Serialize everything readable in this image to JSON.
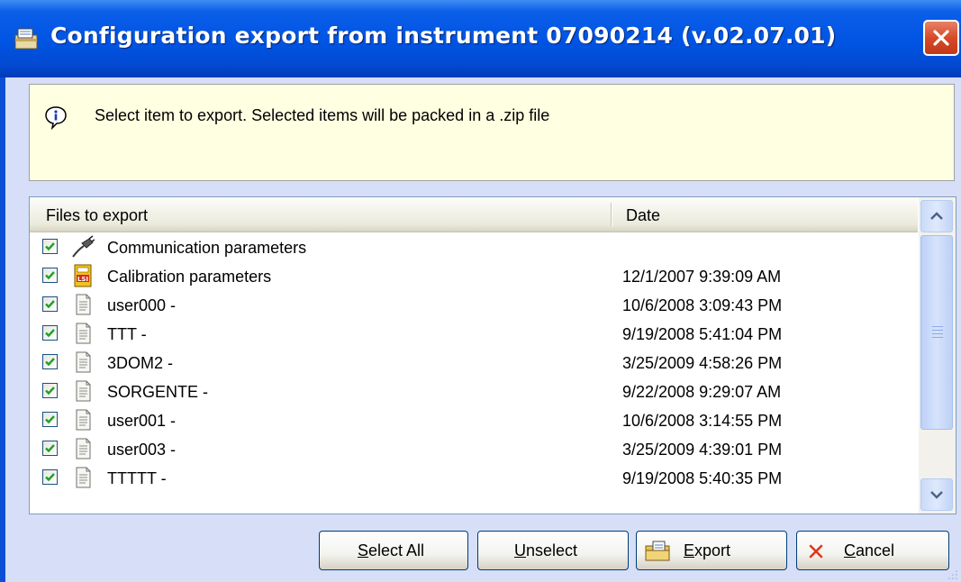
{
  "window": {
    "title": "Configuration export from instrument 07090214 (v.02.07.01)",
    "icon": "export-box-icon",
    "close_icon": "close-icon"
  },
  "info": {
    "icon": "info-balloon-icon",
    "message": "Select item to export. Selected items will be packed in a .zip file"
  },
  "list": {
    "columns": [
      "Files to export",
      "Date"
    ],
    "rows": [
      {
        "checked": true,
        "icon": "communication-plug-icon",
        "name": "Communication parameters",
        "date": ""
      },
      {
        "checked": true,
        "icon": "lsi-calibration-icon",
        "name": "Calibration parameters",
        "date": "12/1/2007 9:39:09 AM"
      },
      {
        "checked": true,
        "icon": "document-icon",
        "name": "user000 -",
        "date": "10/6/2008 3:09:43 PM"
      },
      {
        "checked": true,
        "icon": "document-icon",
        "name": "TTT -",
        "date": "9/19/2008 5:41:04 PM"
      },
      {
        "checked": true,
        "icon": "document-icon",
        "name": "3DOM2 -",
        "date": "3/25/2009 4:58:26 PM"
      },
      {
        "checked": true,
        "icon": "document-icon",
        "name": "SORGENTE -",
        "date": "9/22/2008 9:29:07 AM"
      },
      {
        "checked": true,
        "icon": "document-icon",
        "name": "user001 -",
        "date": "10/6/2008 3:14:55 PM"
      },
      {
        "checked": true,
        "icon": "document-icon",
        "name": "user003 -",
        "date": "3/25/2009 4:39:01 PM"
      },
      {
        "checked": true,
        "icon": "document-icon",
        "name": "TTTTT -",
        "date": "9/19/2008 5:40:35 PM"
      }
    ]
  },
  "buttons": {
    "select_all": "Select All",
    "unselect": "Unselect",
    "export": "Export",
    "cancel": "Cancel"
  },
  "colors": {
    "title_bar": "#0054e3",
    "info_background": "#ffffe1",
    "check_mark": "#21a121",
    "cancel_x": "#e0371c"
  }
}
